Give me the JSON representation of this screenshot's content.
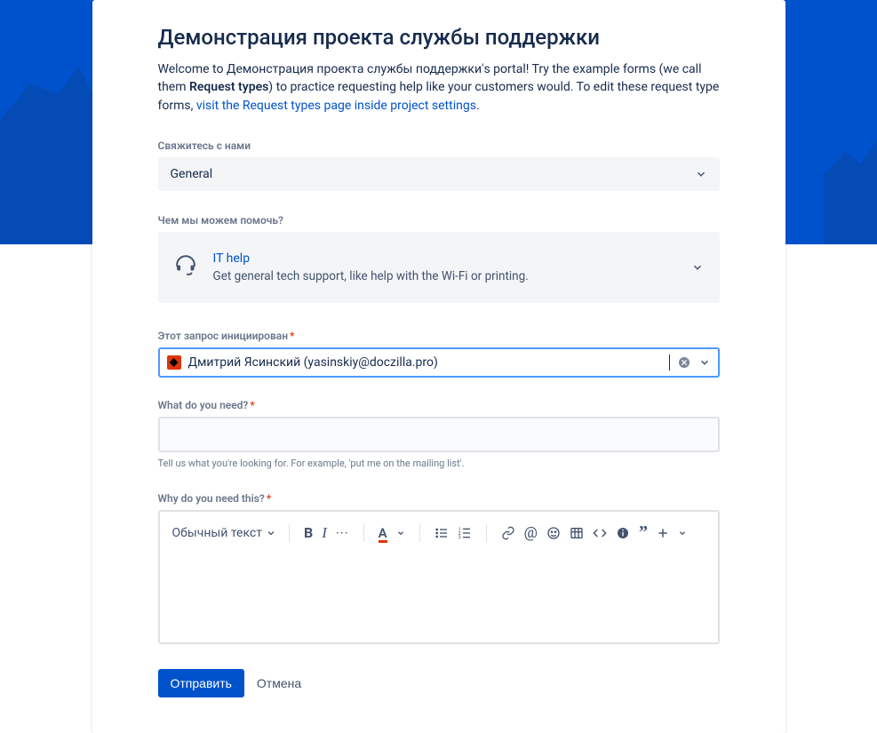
{
  "title": "Демонстрация проекта службы поддержки",
  "welcome_p1": "Welcome to Демонстрация проекта службы поддержки's portal! Try the example forms (we call them ",
  "welcome_bold": "Request types",
  "welcome_p2": ") to practice requesting help like your customers would. To edit these request type forms, ",
  "welcome_link": "visit the Request types page inside project settings",
  "welcome_period": ".",
  "contact": {
    "label": "Свяжитесь с нами",
    "selected": "General"
  },
  "help": {
    "label": "Чем мы можем помочь?",
    "title": "IT help",
    "desc": "Get general tech support, like help with the Wi-Fi or printing."
  },
  "requester": {
    "label": "Этот запрос инициирован",
    "value": "Дмитрий Ясинский (yasinskiy@doczilla.pro)"
  },
  "need": {
    "label": "What do you need?",
    "hint": "Tell us what you're looking for. For example, 'put me on the mailing list'."
  },
  "why": {
    "label": "Why do you need this?"
  },
  "toolbar": {
    "text_style": "Обычный текст"
  },
  "actions": {
    "submit": "Отправить",
    "cancel": "Отмена"
  }
}
